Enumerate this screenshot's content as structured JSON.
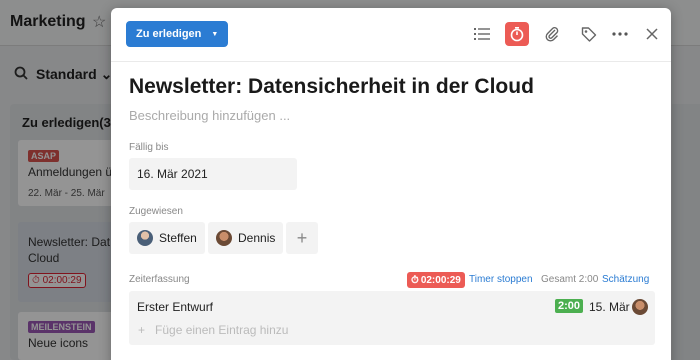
{
  "background": {
    "title": "Marketing",
    "view_label": "Standard",
    "column_title": "Zu erledigen(3)",
    "cards": [
      {
        "tag": "ASAP",
        "tag_color": "#d9534f",
        "title": "Anmeldungen ü",
        "dates": "22. Mär - 25. Mär"
      },
      {
        "title_line1": "Newsletter: Dat",
        "title_line2": "Cloud",
        "timer": "02:00:29"
      },
      {
        "tag": "MEILENSTEIN",
        "tag_color": "#9b59b6",
        "title": "Neue icons"
      }
    ]
  },
  "modal": {
    "status_label": "Zu erledigen",
    "toolbar_icons": [
      "checklist-icon",
      "stopwatch-icon",
      "paperclip-icon",
      "tag-icon",
      "more-icon",
      "close-icon"
    ],
    "title": "Newsletter: Datensicherheit in der Cloud",
    "description_placeholder": "Beschreibung hinzufügen ...",
    "due": {
      "label": "Fällig bis",
      "value": "16. Mär 2021"
    },
    "assigned": {
      "label": "Zugewiesen",
      "people": [
        "Steffen",
        "Dennis"
      ]
    },
    "time_tracking": {
      "label": "Zeiterfassung",
      "running_timer": "02:00:29",
      "stop_label": "Timer stoppen",
      "total": "Gesamt 2:00",
      "estimate_label": "Schätzung",
      "entries": [
        {
          "name": "Erster Entwurf",
          "duration": "2:00",
          "date": "15. Mär"
        }
      ],
      "add_placeholder": "Füge einen Eintrag hinzu"
    }
  },
  "colors": {
    "accent": "#2b7cd3",
    "timer": "#ec5b55",
    "duration": "#4caf50"
  }
}
